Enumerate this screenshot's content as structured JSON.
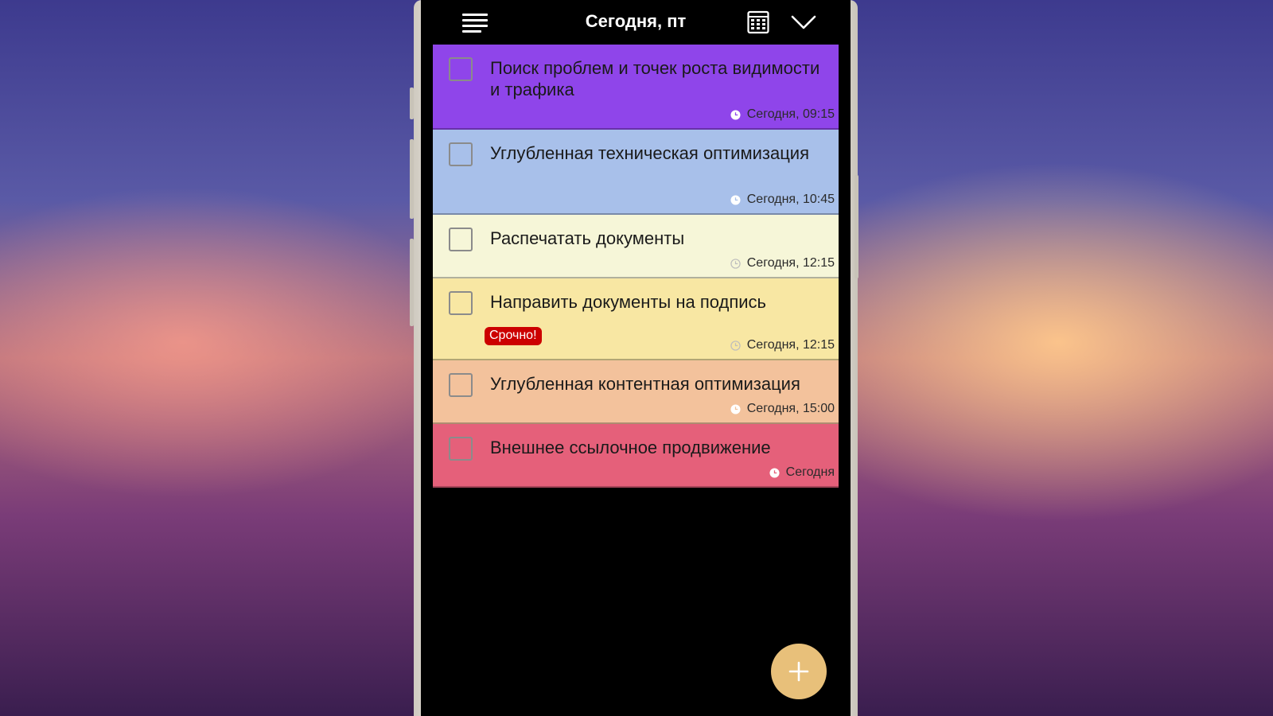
{
  "header": {
    "title": "Сегодня, пт"
  },
  "icons": {
    "menu": "menu-icon",
    "calendar": "calendar-icon",
    "collapse": "chevron-down-icon",
    "clock": "clock-icon",
    "add": "plus-icon"
  },
  "tasks": [
    {
      "title": "Поиск проблем и точек роста видимости и трафика",
      "time": "Сегодня, 09:15",
      "color": "#8f45ea",
      "checked": false
    },
    {
      "title": "Углубленная техническая оптимизация",
      "time": "Сегодня, 10:45",
      "color": "#a8c0ea",
      "checked": false
    },
    {
      "title": "Распечатать документы",
      "time": "Сегодня, 12:15",
      "color": "#f6f6d8",
      "checked": false
    },
    {
      "title": "Направить документы на подпись",
      "badge": "Срочно!",
      "time": "Сегодня, 12:15",
      "color": "#f8e7a3",
      "checked": false
    },
    {
      "title": "Углубленная контентная оптимизация",
      "time": "Сегодня, 15:00",
      "color": "#f3c29c",
      "checked": false
    },
    {
      "title": "Внешнее ссылочное продвижение",
      "time": "Сегодня",
      "color": "#e5607a",
      "checked": false
    }
  ],
  "colors": {
    "badge": "#cc0000",
    "fab": "#e8c07a",
    "screen_bg": "#000000"
  }
}
